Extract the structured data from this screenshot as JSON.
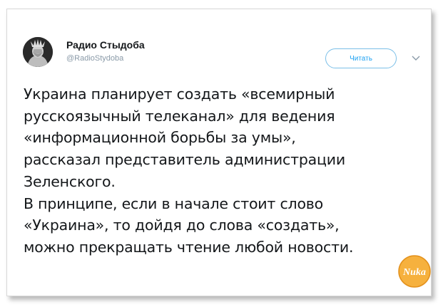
{
  "tweet": {
    "author_name": "Радио Стыдоба",
    "author_handle": "@RadioStydoba",
    "follow_label": "Читать",
    "lines": [
      "Украина планирует создать «всемирный",
      "русскоязычный телеканал» для ведения",
      "«информационной борьбы за умы»,",
      "рассказал представитель администрации",
      "Зеленского.",
      "В принципе, если в начале стоит слово",
      "«Украина», то дойдя до слова «создать»,",
      "можно прекращать чтение любой новости."
    ]
  },
  "watermark": {
    "text": "Nuka"
  },
  "colors": {
    "accent": "#1da1f2",
    "text": "#14171a",
    "muted": "#8a9aa8",
    "watermark": "#f3a21c"
  },
  "icons": {
    "avatar": "statue-of-liberty-facepalm-avatar",
    "menu": "chevron-down-icon"
  }
}
